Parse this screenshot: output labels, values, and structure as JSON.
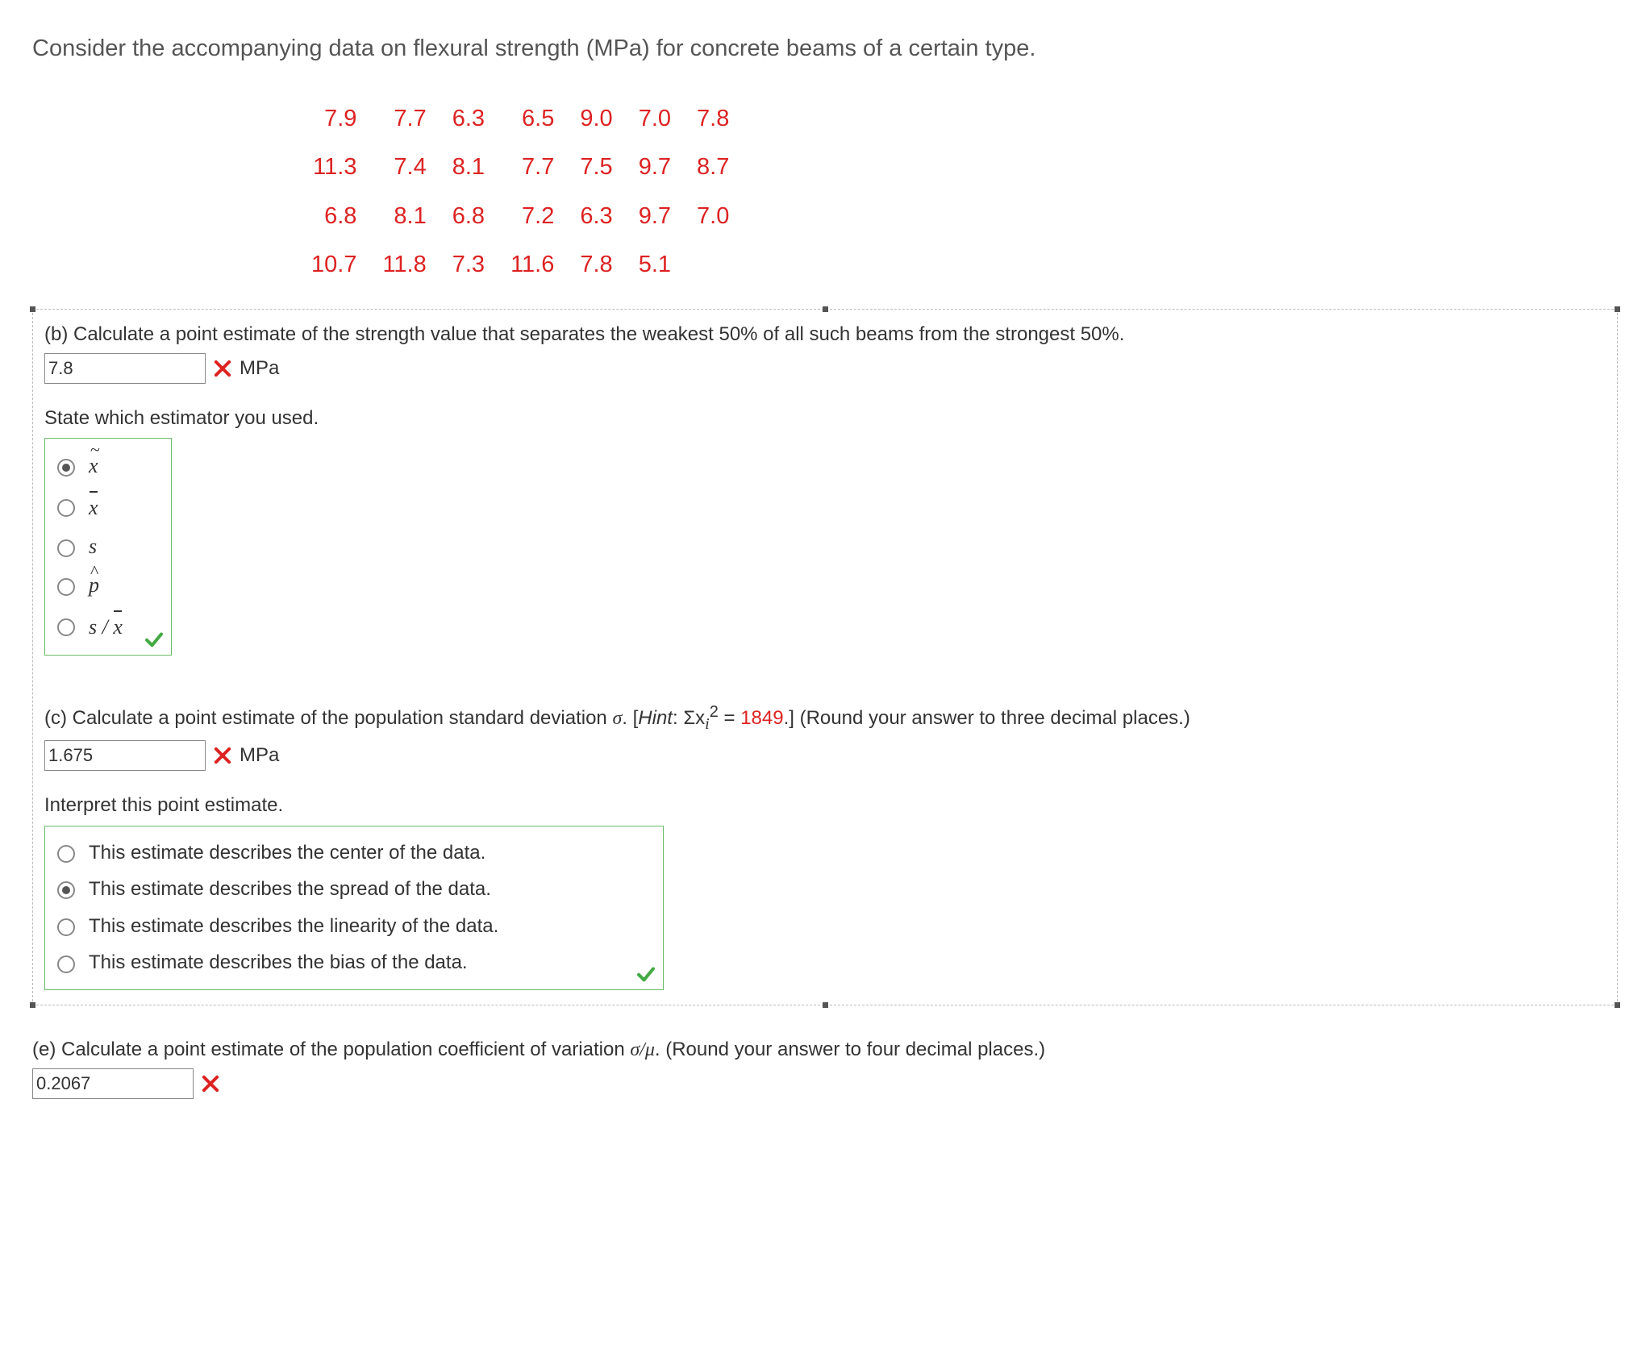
{
  "intro": "Consider the accompanying data on flexural strength (MPa) for concrete beams of a certain type.",
  "data_rows": [
    [
      "7.9",
      "7.7",
      "6.3",
      "6.5",
      "9.0",
      "7.0",
      "7.8"
    ],
    [
      "11.3",
      "7.4",
      "8.1",
      "7.7",
      "7.5",
      "9.7",
      "8.7"
    ],
    [
      "6.8",
      "8.1",
      "6.8",
      "7.2",
      "6.3",
      "9.7",
      "7.0"
    ],
    [
      "10.7",
      "11.8",
      "7.3",
      "11.6",
      "7.8",
      "5.1",
      ""
    ]
  ],
  "partB": {
    "question": "(b) Calculate a point estimate of the strength value that separates the weakest 50% of all such beams from the strongest 50%.",
    "answer_value": "7.8",
    "unit": "MPa",
    "sub_heading": "State which estimator you used.",
    "options_selected_index": 0,
    "options": [
      "x_tilde",
      "x_bar",
      "s",
      "p_hat",
      "s_over_xbar"
    ]
  },
  "partC": {
    "question_pre": "(c) Calculate a point estimate of the population standard deviation ",
    "sigma": "σ",
    "question_mid": ". [",
    "hint_label": "Hint",
    "hint_colon": ": Σx",
    "hint_sub": "i",
    "hint_sup": "2",
    "hint_eq": " = ",
    "hint_value": "1849",
    "question_post": ".] (Round your answer to three decimal places.)",
    "answer_value": "1.675",
    "unit": "MPa",
    "sub_heading": "Interpret this point estimate.",
    "options_selected_index": 1,
    "options": [
      "This estimate describes the center of the data.",
      "This estimate describes the spread of the data.",
      "This estimate describes the linearity of the data.",
      "This estimate describes the bias of the data."
    ]
  },
  "partE": {
    "question_pre": "(e) Calculate a point estimate of the population coefficient of variation ",
    "sigma_mu": "σ/μ",
    "question_post": ". (Round your answer to four decimal places.)",
    "answer_value": "0.2067"
  }
}
